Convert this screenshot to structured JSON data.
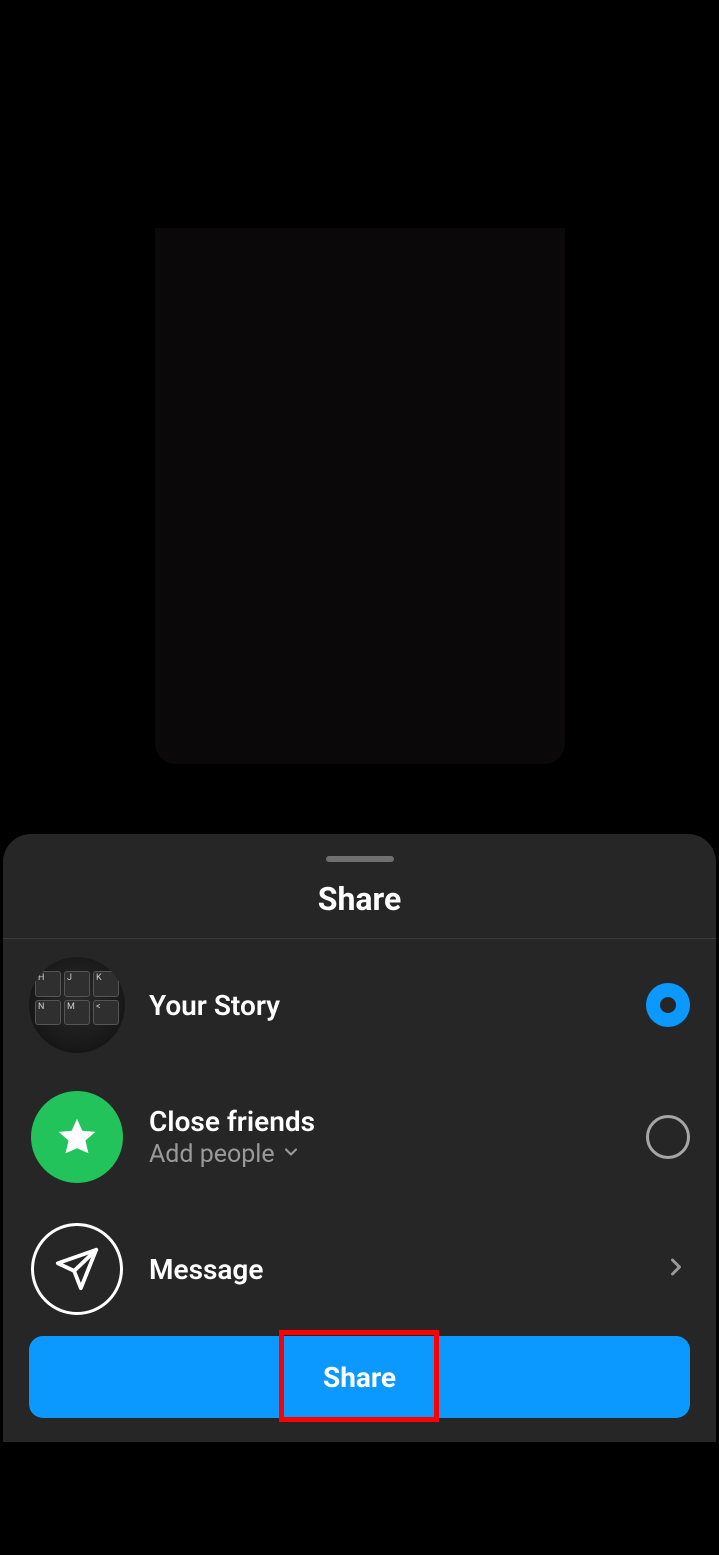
{
  "sheet": {
    "title": "Share",
    "options": [
      {
        "label": "Your Story",
        "icon": "avatar",
        "selected": true
      },
      {
        "label": "Close friends",
        "sublabel": "Add people",
        "icon": "star-green",
        "selected": false
      },
      {
        "label": "Message",
        "icon": "send-ring",
        "trailing": "chevron-right"
      }
    ],
    "primary_button": "Share"
  },
  "colors": {
    "accent": "#0b99ff",
    "green": "#21c35a",
    "sheet_bg": "#262626",
    "highlight": "#ff0000"
  }
}
